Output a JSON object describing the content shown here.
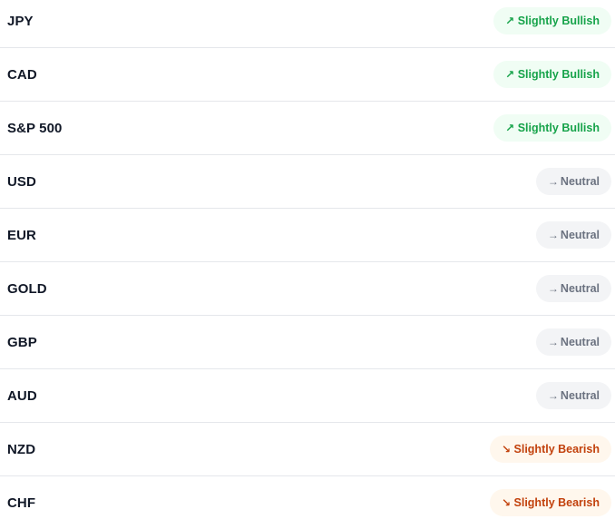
{
  "rows": [
    {
      "asset": "JPY",
      "sentiment": "Slightly Bullish",
      "icon": "arrow-up-right-icon",
      "glyph": "↗",
      "kind": "bullish"
    },
    {
      "asset": "CAD",
      "sentiment": "Slightly Bullish",
      "icon": "arrow-up-right-icon",
      "glyph": "↗",
      "kind": "bullish"
    },
    {
      "asset": "S&P 500",
      "sentiment": "Slightly Bullish",
      "icon": "arrow-up-right-icon",
      "glyph": "↗",
      "kind": "bullish"
    },
    {
      "asset": "USD",
      "sentiment": "Neutral",
      "icon": "arrow-right-icon",
      "glyph": "→",
      "kind": "neutral"
    },
    {
      "asset": "EUR",
      "sentiment": "Neutral",
      "icon": "arrow-right-icon",
      "glyph": "→",
      "kind": "neutral"
    },
    {
      "asset": "GOLD",
      "sentiment": "Neutral",
      "icon": "arrow-right-icon",
      "glyph": "→",
      "kind": "neutral"
    },
    {
      "asset": "GBP",
      "sentiment": "Neutral",
      "icon": "arrow-right-icon",
      "glyph": "→",
      "kind": "neutral"
    },
    {
      "asset": "AUD",
      "sentiment": "Neutral",
      "icon": "arrow-right-icon",
      "glyph": "→",
      "kind": "neutral"
    },
    {
      "asset": "NZD",
      "sentiment": "Slightly Bearish",
      "icon": "arrow-down-right-icon",
      "glyph": "↘",
      "kind": "bearish"
    },
    {
      "asset": "CHF",
      "sentiment": "Slightly Bearish",
      "icon": "arrow-down-right-icon",
      "glyph": "↘",
      "kind": "bearish"
    }
  ],
  "colors": {
    "bullish_text": "#16a34a",
    "bullish_bg": "#f0fdf4",
    "neutral_text": "#6b7280",
    "neutral_bg": "#f3f4f6",
    "bearish_text": "#c2410c",
    "bearish_bg": "#fff7ed",
    "divider": "#e5e7eb"
  }
}
